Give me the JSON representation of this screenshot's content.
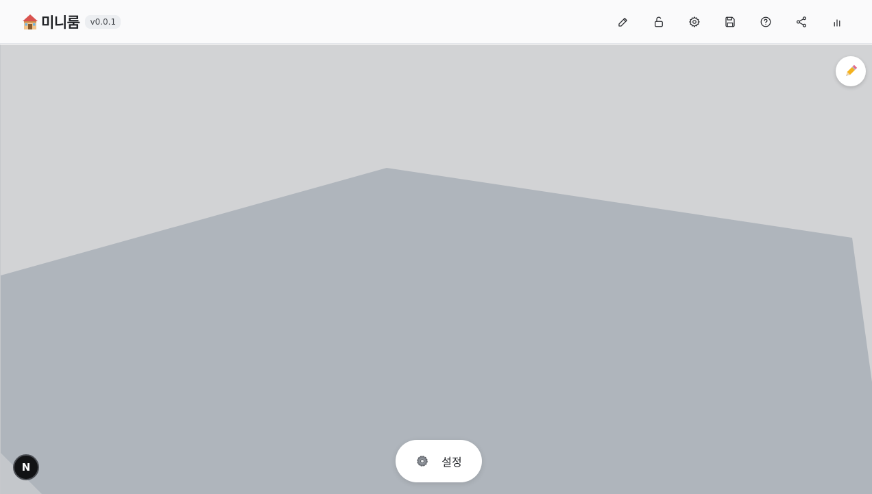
{
  "header": {
    "brand_icon": "house-icon",
    "title": "미니룸",
    "version": "v0.0.1"
  },
  "toolbar": {
    "items": [
      {
        "icon": "pencil-icon"
      },
      {
        "icon": "unlock-icon"
      },
      {
        "icon": "gear-icon"
      },
      {
        "icon": "save-icon"
      },
      {
        "icon": "help-icon"
      },
      {
        "icon": "share-icon"
      },
      {
        "icon": "stats-icon"
      }
    ]
  },
  "canvas": {
    "edit_button_icon": "pencil-emoji-icon",
    "colors": {
      "wall": "#d2d3d5",
      "floor": "#afb5bc"
    }
  },
  "bottom_bar": {
    "settings_icon": "gear-emoji-icon",
    "settings_label": "설정"
  },
  "corner_badge": {
    "label": "N"
  }
}
